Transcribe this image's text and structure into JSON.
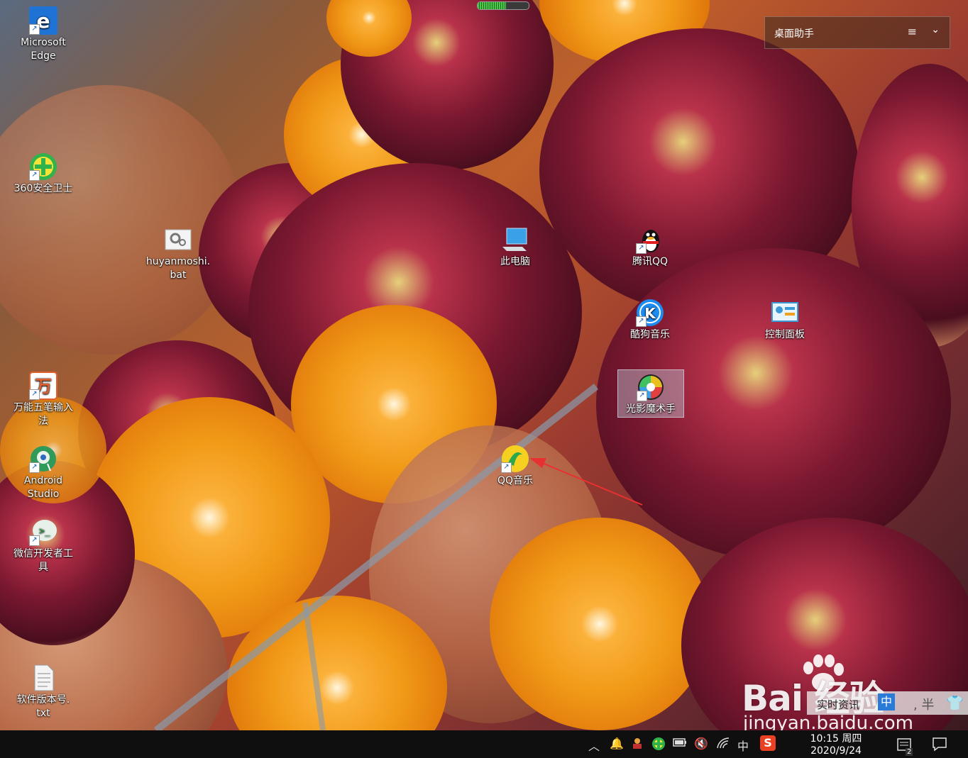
{
  "desktop": {
    "icons": [
      {
        "label": "Microsoft\nEdge",
        "icon": "edge-icon",
        "color": "#1e73d4"
      },
      {
        "label": "360安全卫士",
        "icon": "shield-plus-icon",
        "color": "#2fb34a"
      },
      {
        "label": "huyanmoshi.\nbat",
        "icon": "batch-gear-icon",
        "color": "#cccccc"
      },
      {
        "label": "此电脑",
        "icon": "computer-icon",
        "color": "#3aa0e8"
      },
      {
        "label": "腾讯QQ",
        "icon": "qq-penguin-icon",
        "color": "#111111"
      },
      {
        "label": "酷狗音乐",
        "icon": "kugou-icon",
        "color": "#1c8cf0"
      },
      {
        "label": "控制面板",
        "icon": "control-panel-icon",
        "color": "#3a9ad8"
      },
      {
        "label": "光影魔术手",
        "icon": "aperture-icon",
        "color": "#e8c020"
      },
      {
        "label": "万能五笔输入\n法",
        "icon": "wubi-icon",
        "color": "#e06030"
      },
      {
        "label": "Android\nStudio",
        "icon": "android-studio-icon",
        "color": "#2f9a5a"
      },
      {
        "label": "QQ音乐",
        "icon": "qq-music-icon",
        "color": "#f5d020"
      },
      {
        "label": "微信开发者工\n具",
        "icon": "wechat-dev-icon",
        "color": "#e8f0ea"
      },
      {
        "label": "软件版本号.\ntxt",
        "icon": "text-file-icon",
        "color": "#f0f0f0"
      }
    ]
  },
  "assistant": {
    "title": "桌面助手",
    "menu_icon": "hamburger-icon",
    "expand_icon": "chevron-down-icon"
  },
  "taskbar": {
    "tray_icons": [
      "show-hidden-icon",
      "notification-bell-icon",
      "user-tray-icon",
      "360-tray-icon",
      "battery-icon",
      "volume-muted-icon",
      "wifi-icon"
    ],
    "ime": "中",
    "sogou": "S",
    "time": "10:15 周四",
    "date": "2020/9/24",
    "notification_count": "2"
  },
  "watermark": {
    "brand": "Bai 经验",
    "url": "jingyan.baidu.com",
    "overlay_text": "实时资讯",
    "overlay_badge": "中",
    "overlay_extra": ", 半"
  },
  "annotation_color": "#e83030"
}
